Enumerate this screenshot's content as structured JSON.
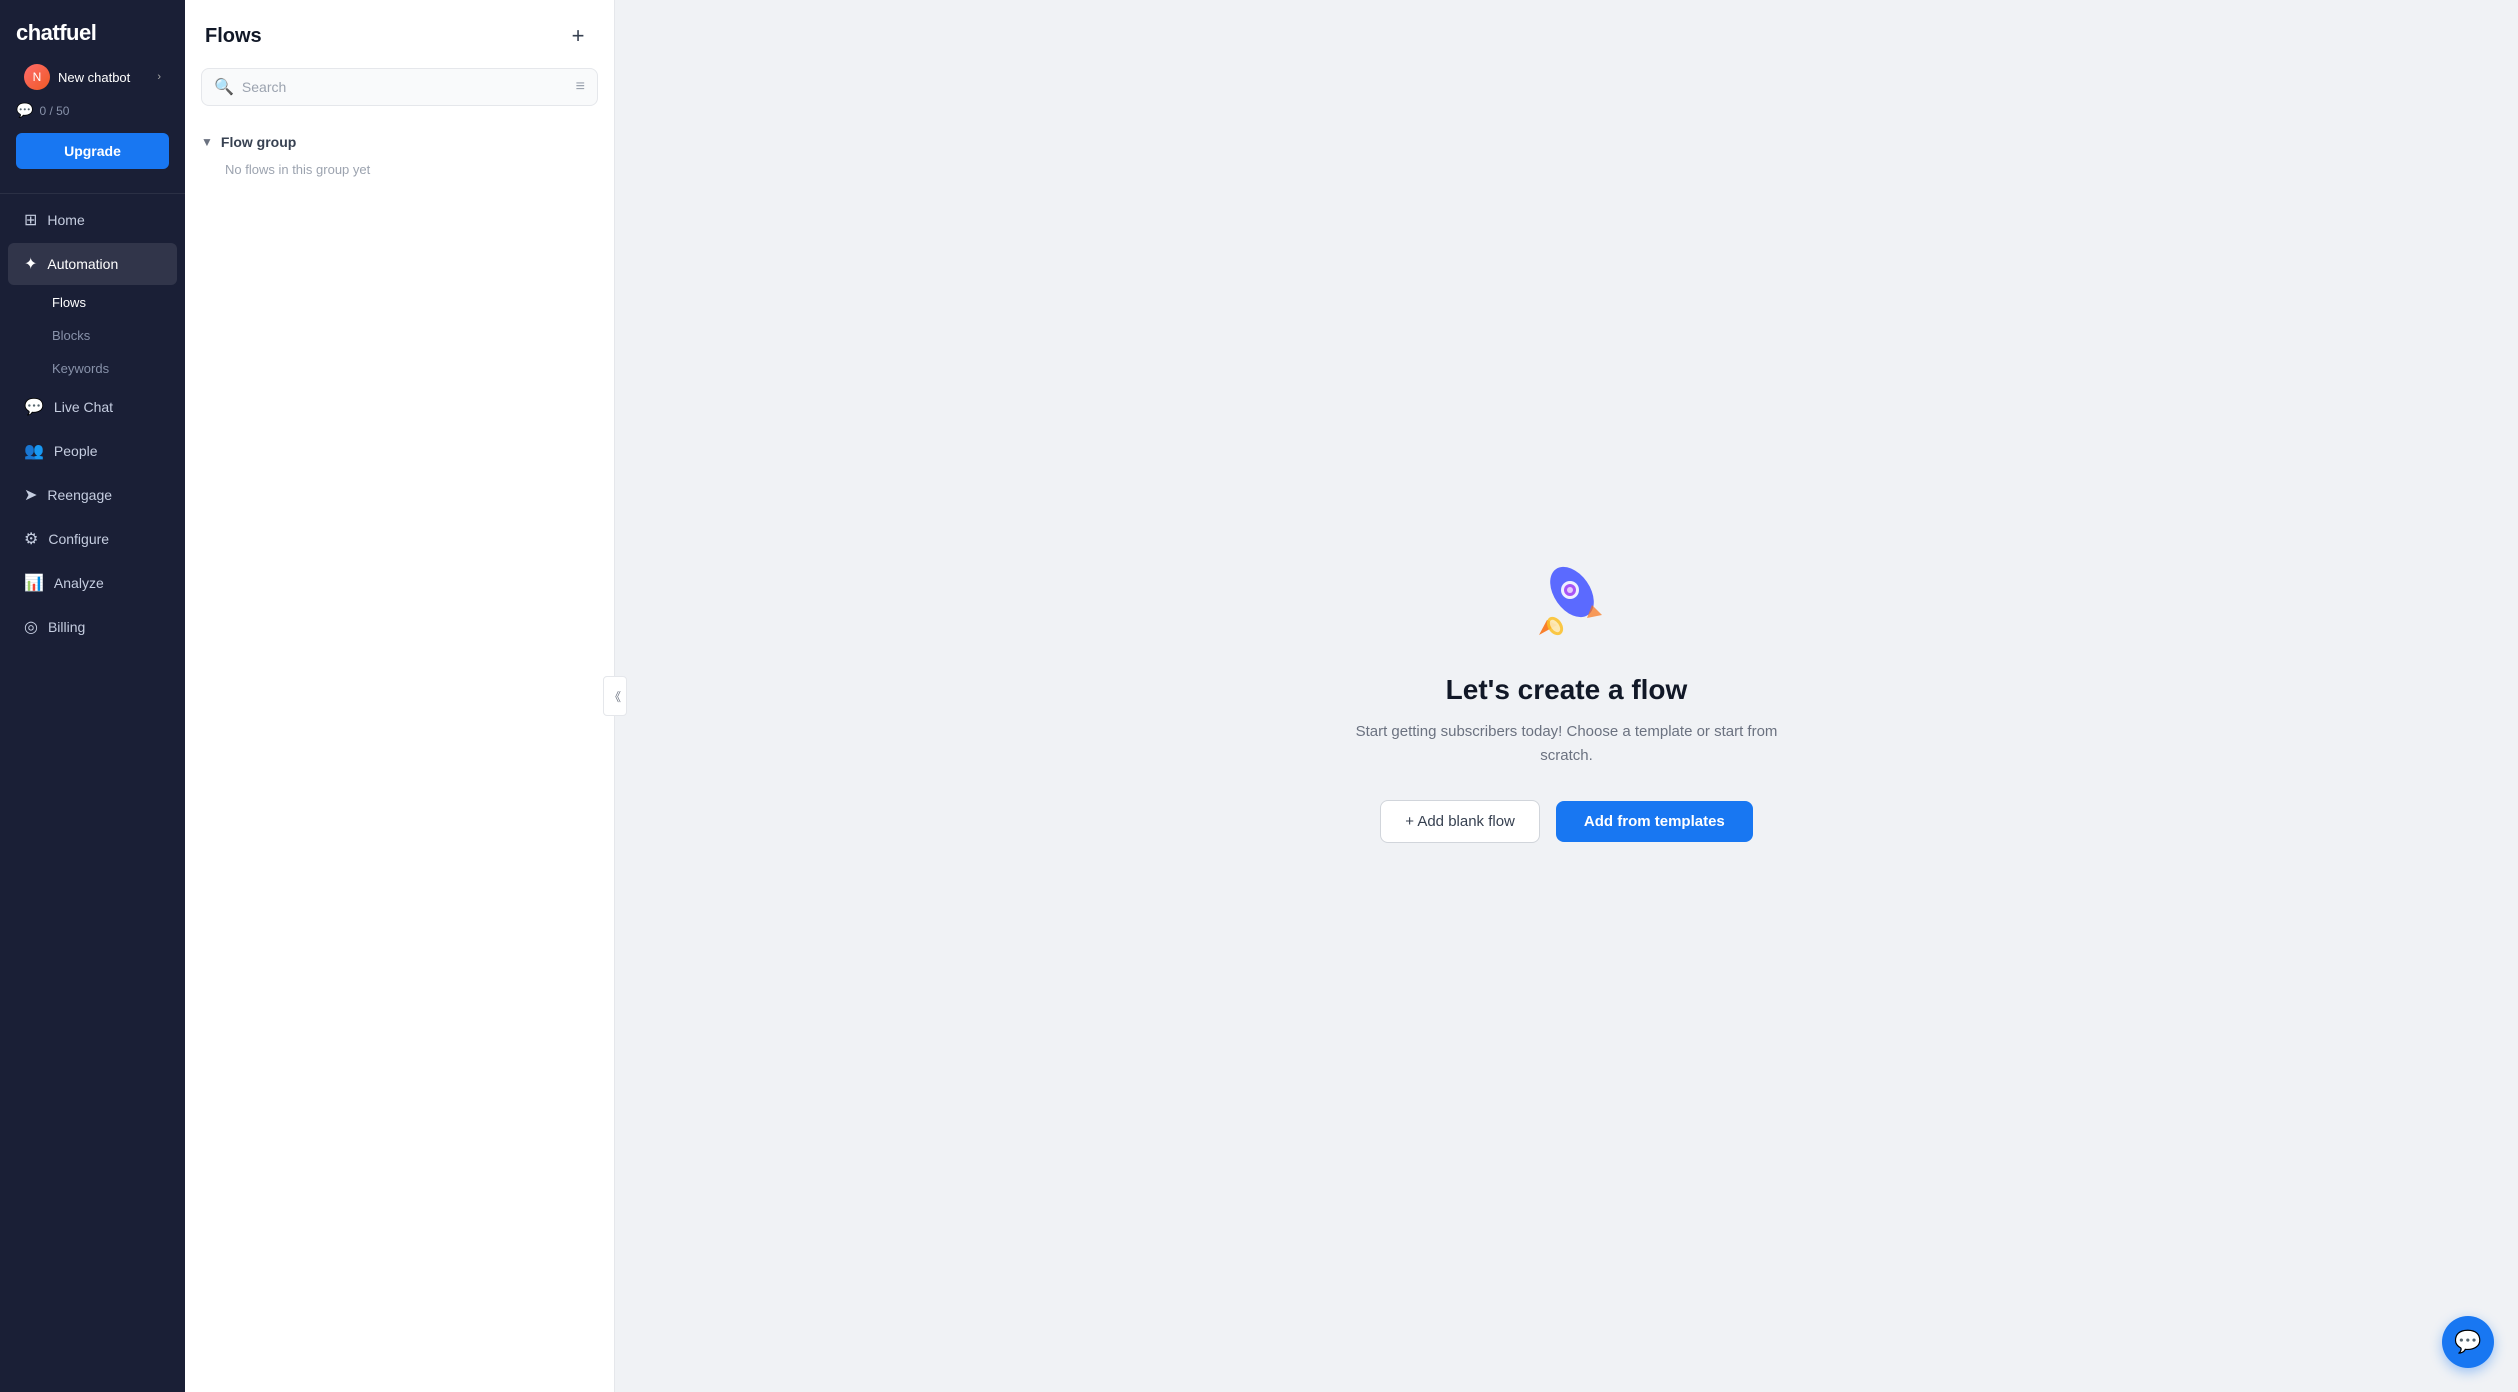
{
  "sidebar": {
    "logo": "chatfuel",
    "chatbot": {
      "name": "New chatbot",
      "arrow": "›"
    },
    "credits": "0 / 50",
    "upgrade_label": "Upgrade",
    "nav_items": [
      {
        "id": "home",
        "label": "Home",
        "icon": "⊞"
      },
      {
        "id": "automation",
        "label": "Automation",
        "icon": "✦",
        "active": true
      },
      {
        "id": "live-chat",
        "label": "Live Chat",
        "icon": "💬"
      },
      {
        "id": "people",
        "label": "People",
        "icon": "👥"
      },
      {
        "id": "reengage",
        "label": "Reengage",
        "icon": "➤"
      },
      {
        "id": "configure",
        "label": "Configure",
        "icon": "⚙"
      },
      {
        "id": "analyze",
        "label": "Analyze",
        "icon": "📊"
      },
      {
        "id": "billing",
        "label": "Billing",
        "icon": "◎"
      }
    ],
    "sub_items": [
      {
        "id": "flows",
        "label": "Flows",
        "active": true
      },
      {
        "id": "blocks",
        "label": "Blocks"
      },
      {
        "id": "keywords",
        "label": "Keywords"
      }
    ]
  },
  "flow_panel": {
    "title": "Flows",
    "add_btn": "+",
    "search_placeholder": "Search",
    "flow_group": {
      "label": "Flow group",
      "empty_text": "No flows in this group yet"
    }
  },
  "main": {
    "title": "Let's create a flow",
    "description": "Start getting subscribers today! Choose a template\nor start from scratch.",
    "btn_blank": "+ Add blank flow",
    "btn_template": "Add from templates"
  }
}
